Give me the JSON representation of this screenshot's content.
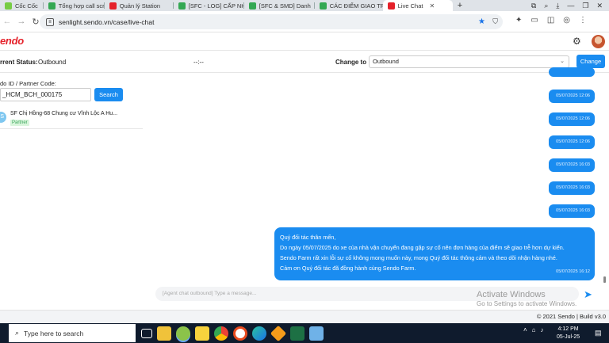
{
  "browser": {
    "tabs": [
      {
        "label": "Cốc Cốc",
        "color": "#e8e8e8",
        "active": false
      },
      {
        "label": "Tổng hợp call scrip",
        "color": "#34a853",
        "active": false
      },
      {
        "label": "Quản lý Station",
        "color": "#e5212a",
        "active": false
      },
      {
        "label": "[SFC - LOG] CẤP NH",
        "color": "#34a853",
        "active": false
      },
      {
        "label": "[SFC & SMD] Danh",
        "color": "#34a853",
        "active": false
      },
      {
        "label": "CÁC ĐIỂM GIAO TR",
        "color": "#34a853",
        "active": false
      },
      {
        "label": "Live Chat",
        "color": "#e5212a",
        "active": true
      }
    ],
    "new_tab_icon": "plus",
    "url": "senlight.sendo.vn/case/live-chat"
  },
  "app": {
    "logo": "endo",
    "status_label": "rrent Status:",
    "status_value": "Outbound",
    "timer": "--:--",
    "change_to_label": "Change to",
    "change_to_value": "Outbound",
    "change_button": "Change"
  },
  "left_panel": {
    "search_label": "do ID / Partner Code:",
    "search_value": "_HCM_BCH_000175",
    "search_button": "Search",
    "partner": {
      "avatar_letter": "S",
      "name": "SF Chị Hồng-68 Chung cư Vĩnh Lộc A Hu...",
      "badge": "Partner"
    }
  },
  "chat": {
    "messages": [
      {
        "time": "05/07/2025 12:06"
      },
      {
        "time": "05/07/2025 12:06"
      },
      {
        "time": "05/07/2025 12:06"
      },
      {
        "time": "05/07/2025 16:03"
      },
      {
        "time": "05/07/2025 16:03"
      },
      {
        "time": "05/07/2025 16:03"
      }
    ],
    "long_message": {
      "lines": [
        "Quý đối tác thân mến,",
        "Do ngày 05/07/2025 do xe của nhà vận chuyển đang gặp sự cố nên đơn hàng của điểm sẽ giao trễ hơn dự kiến.",
        "Sendo Farm rất xin lỗi sự cố không mong muốn này, mong  Quý đối tác thông cảm và theo dõi nhận hàng nhé.",
        "Cảm ơn Quý đối tác đã đồng hành cùng Sendo Farm."
      ],
      "time": "05/07/2025 16:12"
    },
    "input_placeholder": "[Agent chat outbound] Type a message..."
  },
  "watermark": {
    "line1": "Activate Windows",
    "line2": "Go to Settings to activate Windows."
  },
  "footer": {
    "text": "© 2021 Sendo | Build v3.0"
  },
  "taskbar": {
    "search_placeholder": "Type here to search",
    "time": "4:12 PM",
    "date": "05-Jul-25"
  }
}
